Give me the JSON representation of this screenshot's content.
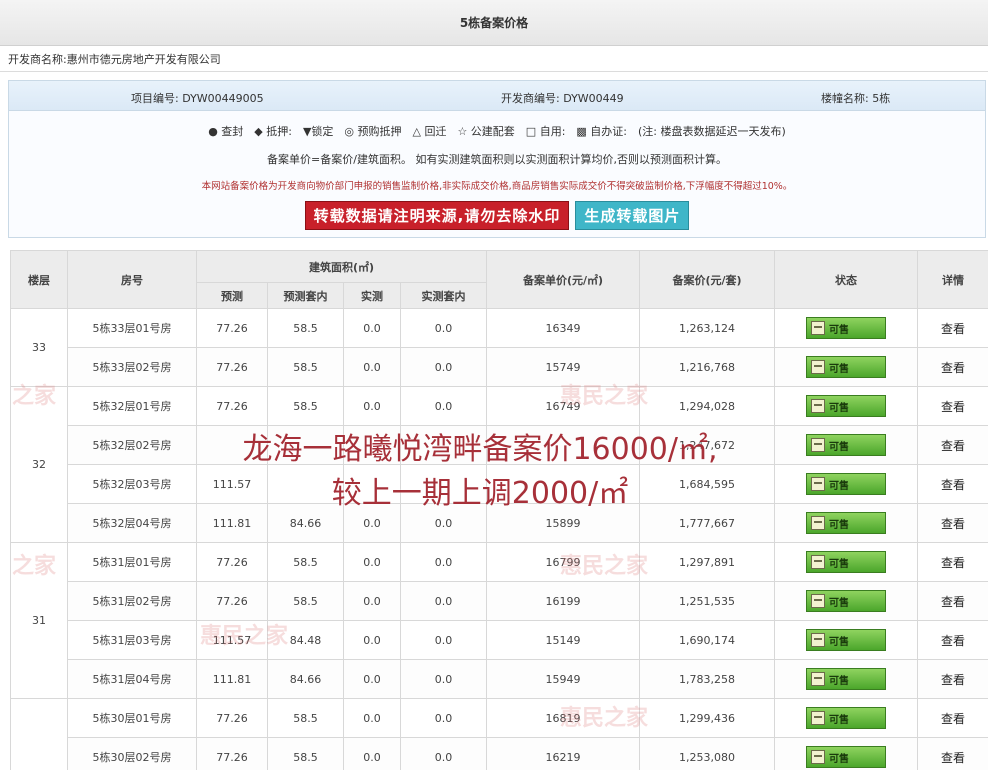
{
  "page": {
    "title": "5栋备案价格",
    "developer_label": "开发商名称:",
    "developer_name": "惠州市德元房地产开发有限公司"
  },
  "info": {
    "project_code": "项目编号: DYW00449005",
    "developer_code": "开发商编号: DYW00449",
    "building_name": "楼幢名称: 5栋",
    "legend": "● 查封　◆ 抵押:　▼锁定　◎ 预购抵押　△ 回迁　☆ 公建配套　□ 自用:　▩ 自办证:　(注: 楼盘表数据延迟一天发布)",
    "formula": "备案单价=备案价/建筑面积。 如有实测建筑面积则以实测面积计算均价,否则以预测面积计算。",
    "disclaimer": "本网站备案价格为开发商向物价部门申报的销售监制价格,非实际成交价格,商品房销售实际成交价不得突破监制价格,下浮幅度不得超过10%。",
    "btn_repost": "转载数据请注明来源,请勿去除水印",
    "btn_generate": "生成转载图片"
  },
  "table": {
    "headers": {
      "floor": "楼层",
      "room": "房号",
      "area_group": "建筑面积(㎡)",
      "pred": "预测",
      "pred_inner": "预测套内",
      "actual": "实测",
      "actual_inner": "实测套内",
      "unit_price": "备案单价(元/㎡)",
      "total_price": "备案价(元/套)",
      "status": "状态",
      "detail": "详情"
    },
    "status_label": "可售",
    "detail_label": "查看",
    "floors": [
      "33",
      "32",
      "31"
    ],
    "rows": [
      {
        "room": "5栋33层01号房",
        "pred": "77.26",
        "pred_inner": "58.5",
        "actual": "0.0",
        "actual_inner": "0.0",
        "unit": "16349",
        "total": "1,263,124"
      },
      {
        "room": "5栋33层02号房",
        "pred": "77.26",
        "pred_inner": "58.5",
        "actual": "0.0",
        "actual_inner": "0.0",
        "unit": "15749",
        "total": "1,216,768"
      },
      {
        "room": "5栋32层01号房",
        "pred": "77.26",
        "pred_inner": "58.5",
        "actual": "0.0",
        "actual_inner": "0.0",
        "unit": "16749",
        "total": "1,294,028"
      },
      {
        "room": "5栋32层02号房",
        "pred": "",
        "pred_inner": "",
        "actual": "",
        "actual_inner": "",
        "unit": "",
        "total": "1,247,672"
      },
      {
        "room": "5栋32层03号房",
        "pred": "111.57",
        "pred_inner": "",
        "actual": "",
        "actual_inner": "",
        "unit": "",
        "total": "1,684,595"
      },
      {
        "room": "5栋32层04号房",
        "pred": "111.81",
        "pred_inner": "84.66",
        "actual": "0.0",
        "actual_inner": "0.0",
        "unit": "15899",
        "total": "1,777,667"
      },
      {
        "room": "5栋31层01号房",
        "pred": "77.26",
        "pred_inner": "58.5",
        "actual": "0.0",
        "actual_inner": "0.0",
        "unit": "16799",
        "total": "1,297,891"
      },
      {
        "room": "5栋31层02号房",
        "pred": "77.26",
        "pred_inner": "58.5",
        "actual": "0.0",
        "actual_inner": "0.0",
        "unit": "16199",
        "total": "1,251,535"
      },
      {
        "room": "5栋31层03号房",
        "pred": "111.57",
        "pred_inner": "84.48",
        "actual": "0.0",
        "actual_inner": "0.0",
        "unit": "15149",
        "total": "1,690,174"
      },
      {
        "room": "5栋31层04号房",
        "pred": "111.81",
        "pred_inner": "84.66",
        "actual": "0.0",
        "actual_inner": "0.0",
        "unit": "15949",
        "total": "1,783,258"
      },
      {
        "room": "5栋30层01号房",
        "pred": "77.26",
        "pred_inner": "58.5",
        "actual": "0.0",
        "actual_inner": "0.0",
        "unit": "16819",
        "total": "1,299,436"
      },
      {
        "room": "5栋30层02号房",
        "pred": "77.26",
        "pred_inner": "58.5",
        "actual": "0.0",
        "actual_inner": "0.0",
        "unit": "16219",
        "total": "1,253,080"
      }
    ]
  },
  "overlay": {
    "line1": "龙海一路曦悦湾畔备案价16000/㎡,",
    "line2": "较上一期上调2000/㎡"
  }
}
